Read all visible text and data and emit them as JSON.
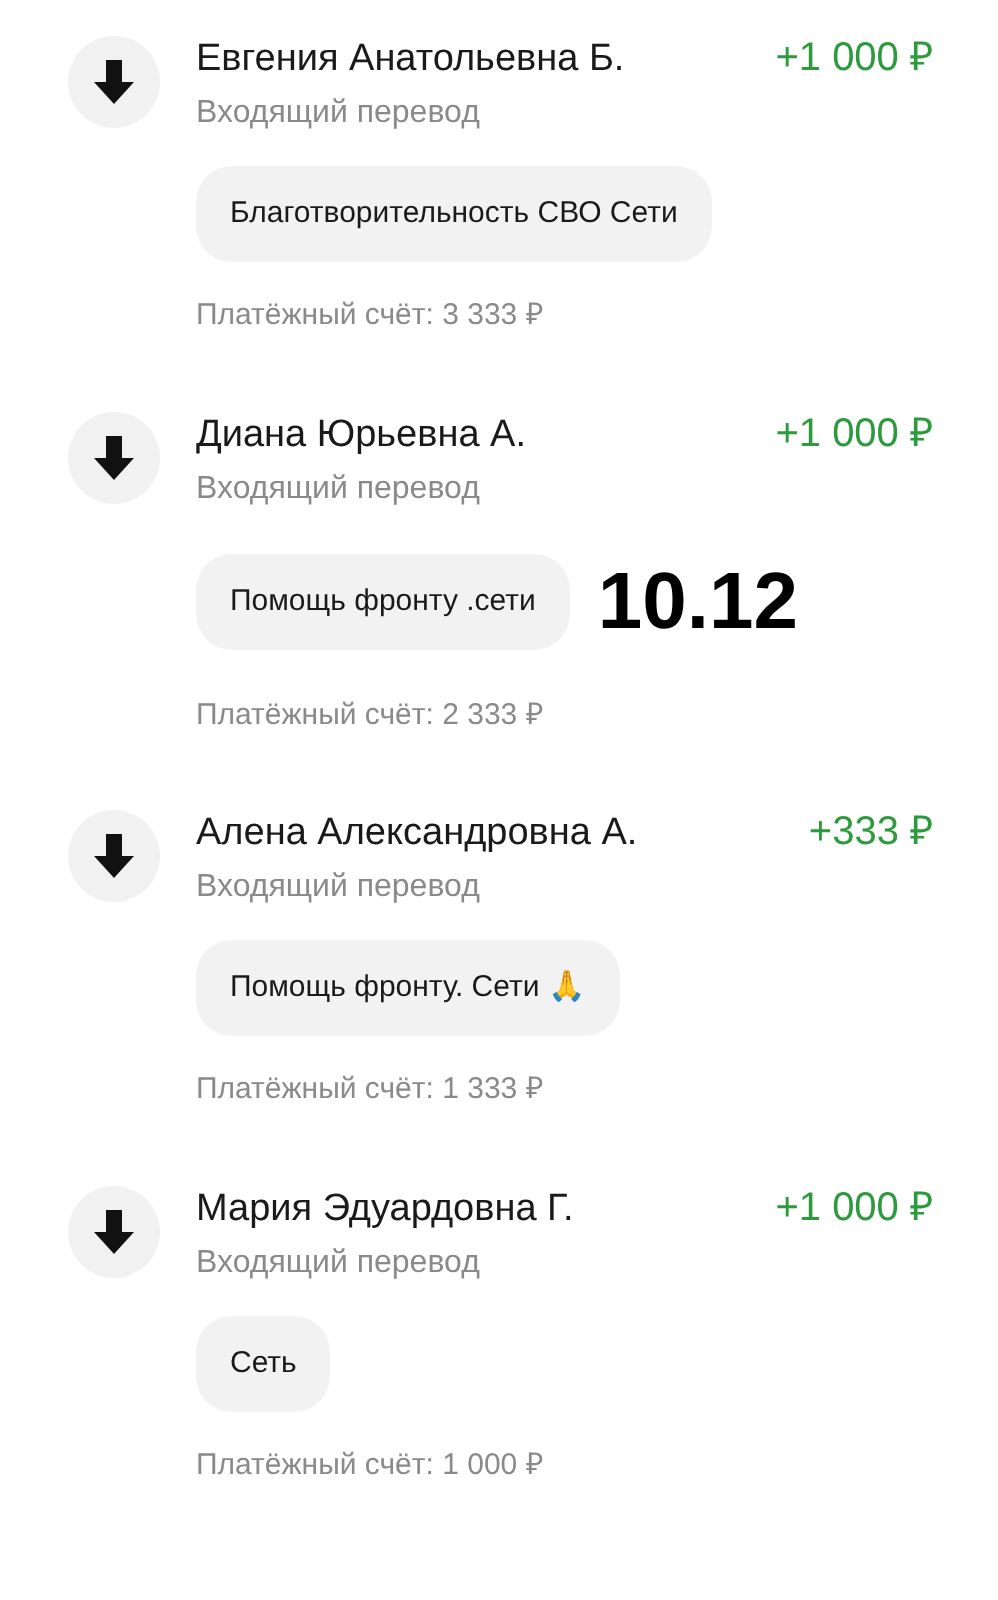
{
  "transactions": [
    {
      "name": "Евгения Анатольевна Б.",
      "amount": "+1 000 ₽",
      "type": "Входящий перевод",
      "message": "Благотворительность СВО Сети",
      "account": "Платёжный счёт: 3 333 ₽"
    },
    {
      "name": "Диана Юрьевна А.",
      "amount": "+1 000 ₽",
      "type": "Входящий перевод",
      "message": "Помощь фронту .сети",
      "account": "Платёжный счёт: 2 333 ₽",
      "date_stamp": "10.12"
    },
    {
      "name": "Алена Александровна А.",
      "amount": "+333 ₽",
      "type": "Входящий перевод",
      "message": "Помощь фронту. Сети 🙏",
      "account": "Платёжный счёт: 1 333 ₽"
    },
    {
      "name": "Мария Эдуардовна Г.",
      "amount": "+1 000 ₽",
      "type": "Входящий перевод",
      "message": "Сеть",
      "account": "Платёжный счёт: 1 000 ₽"
    }
  ]
}
